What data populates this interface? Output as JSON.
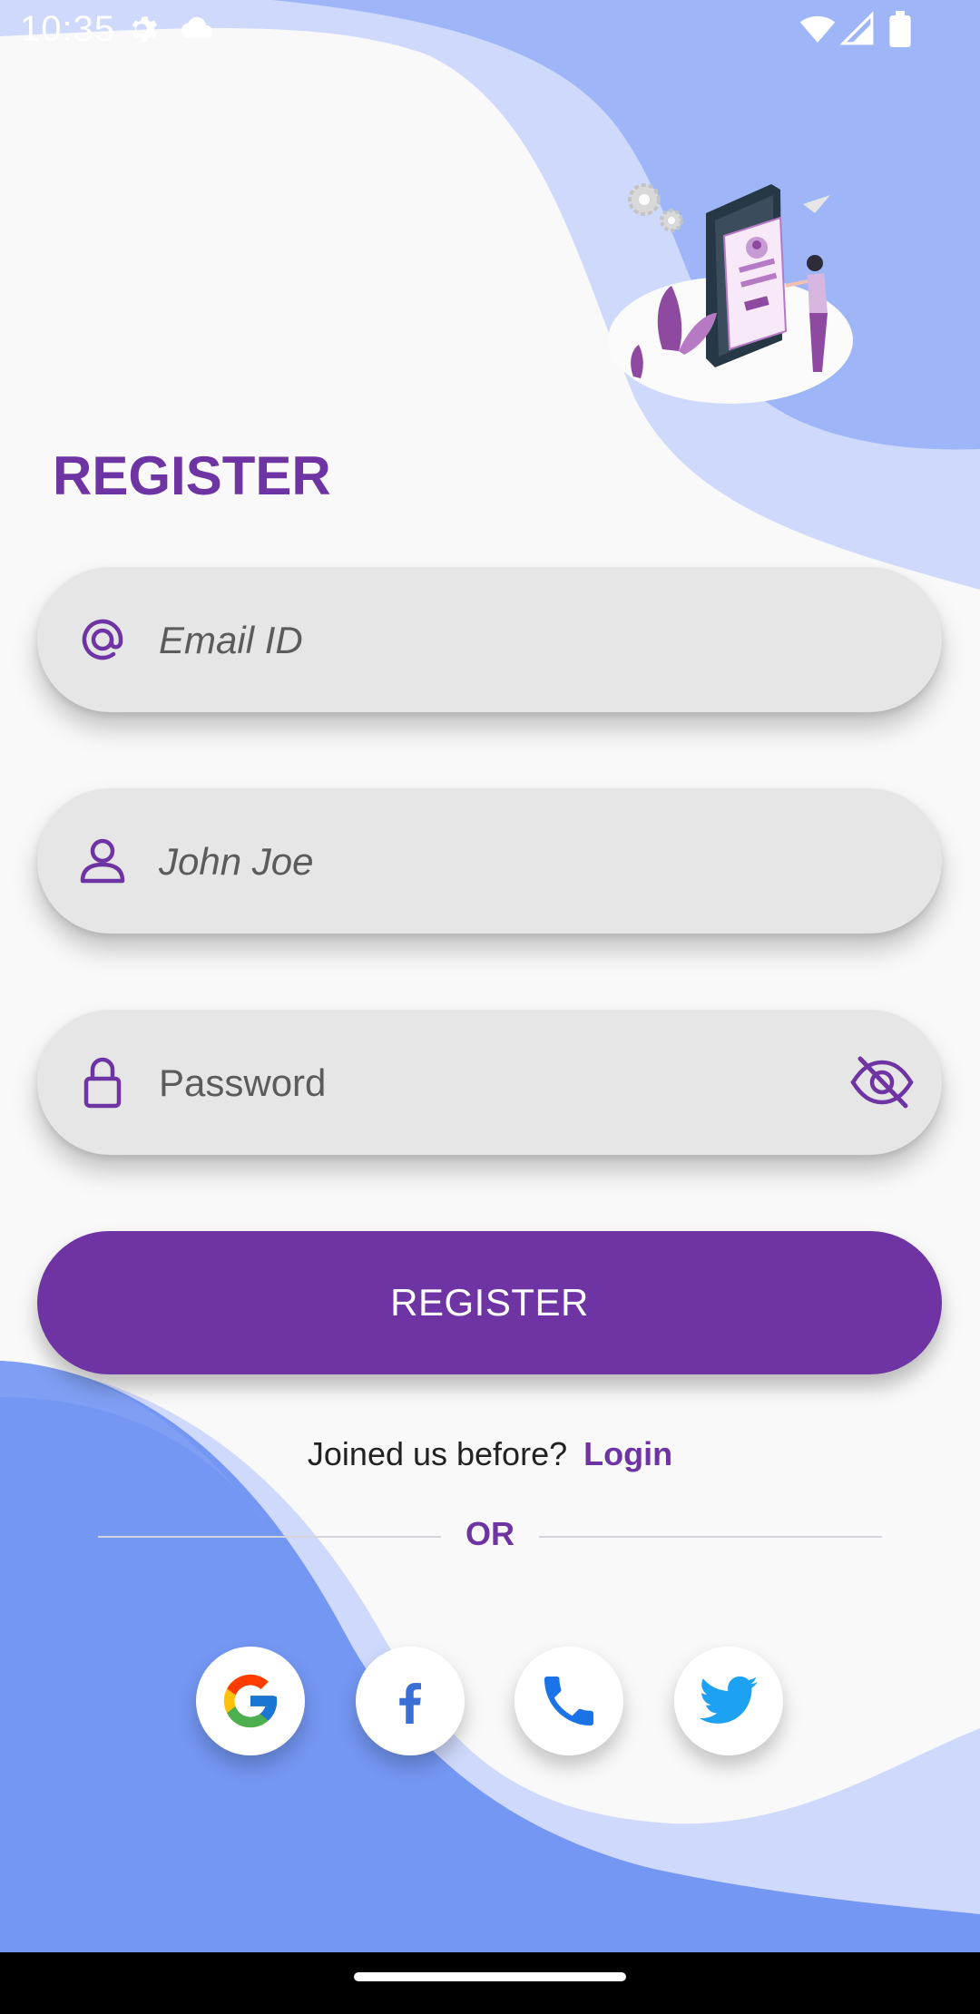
{
  "status_bar": {
    "time": "10:35",
    "left_icons": [
      "settings-icon",
      "cloud-icon"
    ],
    "right_icons": [
      "wifi-icon",
      "cellular-signal-icon",
      "battery-icon"
    ]
  },
  "illustration": {
    "icon": "registration-illustration"
  },
  "title": "REGISTER",
  "fields": {
    "email": {
      "placeholder": "Email ID",
      "icon": "at-sign-icon"
    },
    "name": {
      "placeholder": "John Joe",
      "icon": "person-icon"
    },
    "password": {
      "placeholder": "Password",
      "icon": "lock-icon",
      "toggle_icon": "eye-off-icon"
    }
  },
  "register_button": {
    "label": "REGISTER"
  },
  "login_prompt": {
    "text": "Joined us before?",
    "link": "Login"
  },
  "divider_text": "OR",
  "social_buttons": [
    {
      "name": "google",
      "icon": "google-icon"
    },
    {
      "name": "facebook",
      "icon": "facebook-icon"
    },
    {
      "name": "phone",
      "icon": "phone-icon"
    },
    {
      "name": "twitter",
      "icon": "twitter-icon"
    }
  ],
  "colors": {
    "accent": "#6f34a3",
    "field_bg": "#e6e6e6",
    "wave_light": "#cfd9fb",
    "wave_mid": "#9eb6f7",
    "wave_dark": "#6f94f3",
    "page_bg": "#f9f9f9"
  }
}
